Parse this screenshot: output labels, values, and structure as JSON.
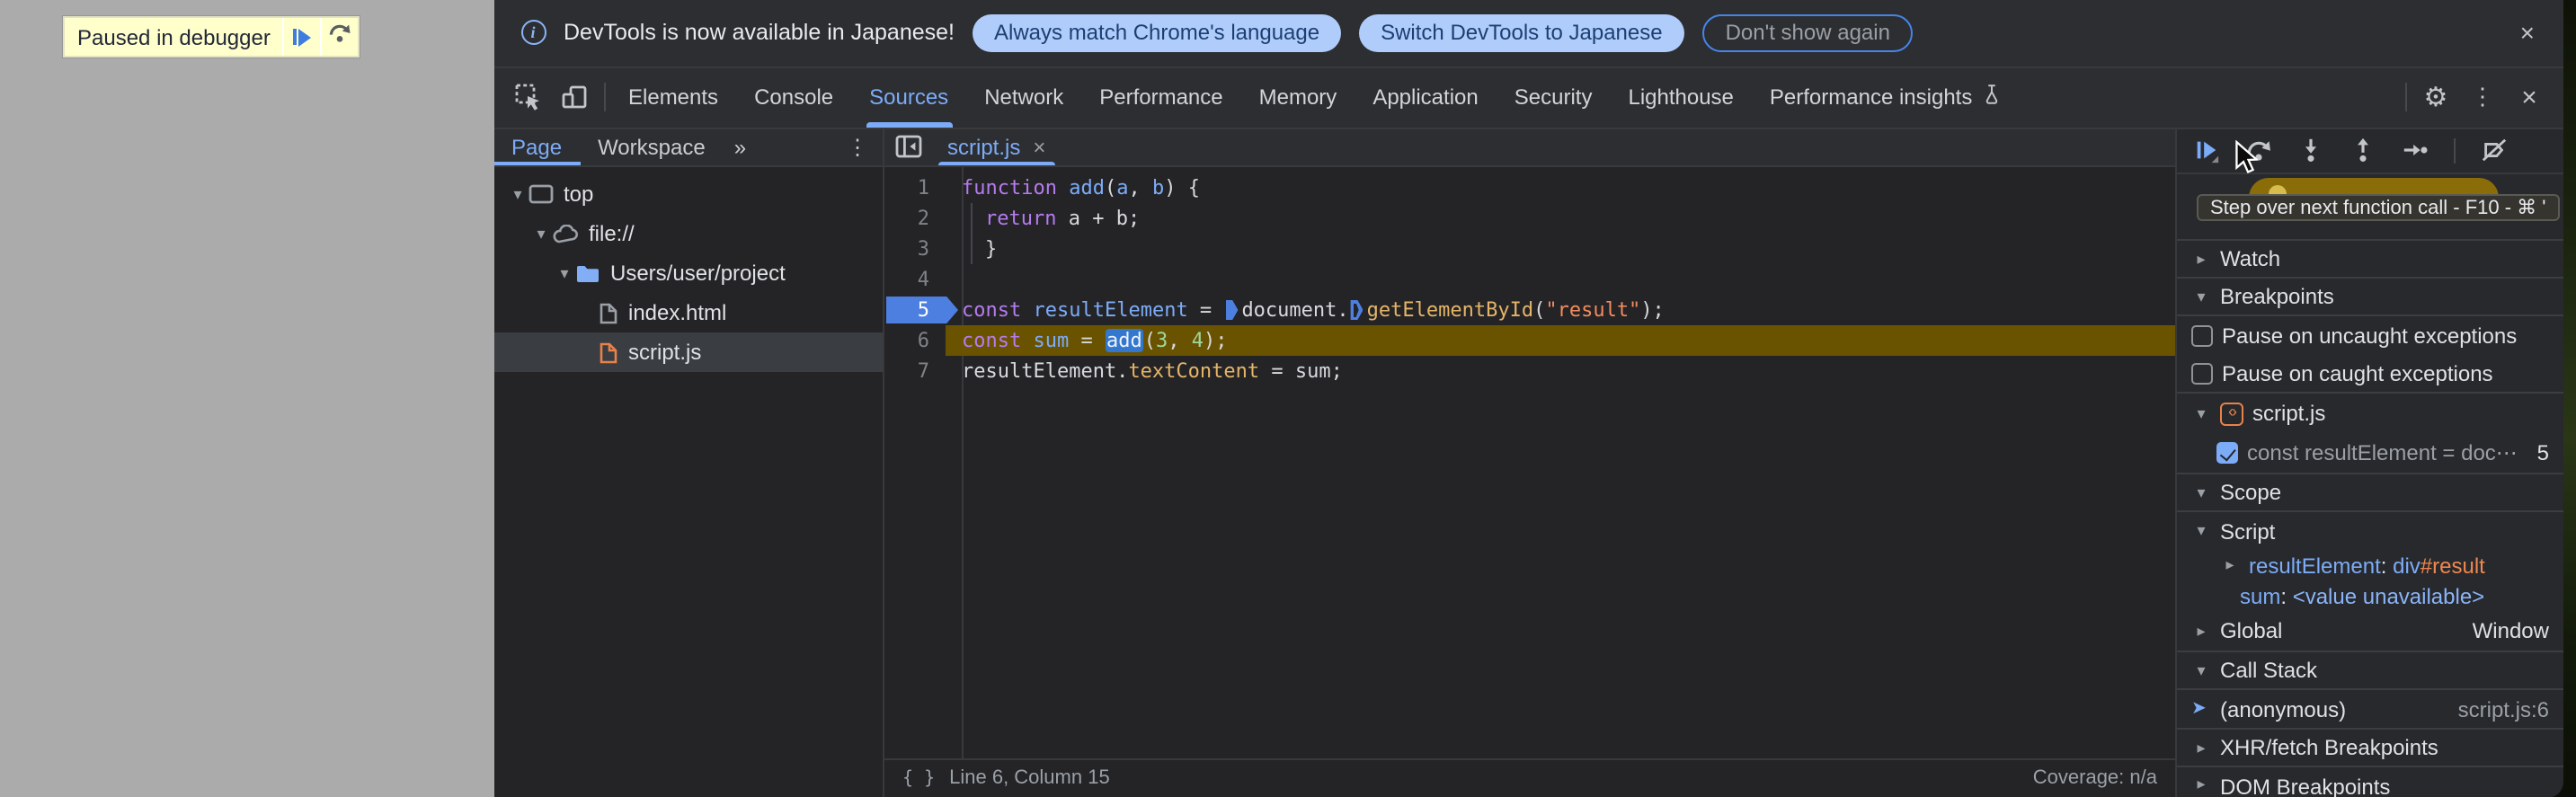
{
  "page_overlay": {
    "label": "Paused in debugger"
  },
  "banner": {
    "message": "DevTools is now available in Japanese!",
    "action_primary": "Always match Chrome's language",
    "action_secondary": "Switch DevTools to Japanese",
    "action_dismiss": "Don't show again"
  },
  "toolbar": {
    "tabs": [
      "Elements",
      "Console",
      "Sources",
      "Network",
      "Performance",
      "Memory",
      "Application",
      "Security",
      "Lighthouse",
      "Performance insights"
    ],
    "active_tab": "Sources"
  },
  "glyphs": {
    "kebab": "⋮",
    "close": "×",
    "gear": "⚙",
    "more": "»",
    "chevron_down": "▾",
    "chevron_right": "▸",
    "callstack_arrow": "➤",
    "code_icon": "‹›",
    "braces": "{ }",
    "info": "i"
  },
  "navigator": {
    "tab_page": "Page",
    "tab_workspace": "Workspace",
    "tree": [
      {
        "label": "top"
      },
      {
        "label": "file://"
      },
      {
        "label": "Users/user/project"
      },
      {
        "label": "index.html"
      },
      {
        "label": "script.js"
      }
    ]
  },
  "editor": {
    "open_tab": "script.js",
    "lines": [
      {
        "no": "1",
        "tokens": [
          {
            "t": "kw",
            "s": "function"
          },
          {
            "t": "p",
            "s": " "
          },
          {
            "t": "def",
            "s": "add"
          },
          {
            "t": "p",
            "s": "("
          },
          {
            "t": "def",
            "s": "a"
          },
          {
            "t": "p",
            "s": ", "
          },
          {
            "t": "def",
            "s": "b"
          },
          {
            "t": "p",
            "s": ") {"
          }
        ]
      },
      {
        "no": "2",
        "tokens": [
          {
            "t": "kw",
            "s": "return"
          },
          {
            "t": "p",
            "s": " a + b;"
          }
        ]
      },
      {
        "no": "3",
        "tokens": [
          {
            "t": "p",
            "s": "}"
          }
        ]
      },
      {
        "no": "4",
        "tokens": []
      },
      {
        "no": "5",
        "tokens": [
          {
            "t": "kw",
            "s": "const"
          },
          {
            "t": "p",
            "s": " "
          },
          {
            "t": "def",
            "s": "resultElement"
          },
          {
            "t": "p",
            "s": " = "
          },
          {
            "t": "mk"
          },
          {
            "t": "p",
            "s": "document."
          },
          {
            "t": "mko"
          },
          {
            "t": "call",
            "s": "getElementById"
          },
          {
            "t": "p",
            "s": "("
          },
          {
            "t": "str",
            "s": "\"result\""
          },
          {
            "t": "p",
            "s": ");"
          }
        ]
      },
      {
        "no": "6",
        "tokens": [
          {
            "t": "kw",
            "s": "const"
          },
          {
            "t": "p",
            "s": " "
          },
          {
            "t": "def",
            "s": "sum"
          },
          {
            "t": "p",
            "s": " = "
          },
          {
            "t": "sel",
            "s": "add"
          },
          {
            "t": "p",
            "s": "("
          },
          {
            "t": "num",
            "s": "3"
          },
          {
            "t": "p",
            "s": ", "
          },
          {
            "t": "num",
            "s": "4"
          },
          {
            "t": "p",
            "s": ");"
          }
        ]
      },
      {
        "no": "7",
        "tokens": [
          {
            "t": "p",
            "s": "resultElement."
          },
          {
            "t": "call",
            "s": "textContent"
          },
          {
            "t": "p",
            "s": " = sum;"
          }
        ]
      }
    ],
    "status": {
      "position": "Line 6, Column 15",
      "coverage": "Coverage: n/a"
    }
  },
  "debugger": {
    "tooltip": "Step over next function call - F10 - ⌘ '",
    "watch_label": "Watch",
    "breakpoints_label": "Breakpoints",
    "pause_uncaught": "Pause on uncaught exceptions",
    "pause_caught": "Pause on caught exceptions",
    "bp_file": "script.js",
    "bp_entry": {
      "code": "const resultElement = doc⋯",
      "line": "5"
    },
    "scope_label": "Scope",
    "scope_script_label": "Script",
    "var1": {
      "name": "resultElement",
      "sep": ": ",
      "value_tag": "div",
      "value_id": "#result"
    },
    "var2": {
      "name": "sum",
      "sep": ": ",
      "value": "<value unavailable>"
    },
    "global_label": "Global",
    "global_value": "Window",
    "callstack_label": "Call Stack",
    "frame": {
      "name": "(anonymous)",
      "location": "script.js:6"
    },
    "xhr_label": "XHR/fetch Breakpoints",
    "dom_label": "DOM Breakpoints"
  },
  "colors": {
    "accent_blue": "#7cacf8",
    "paused_overlay_bg": "#ffffcb",
    "execution_line_bg": "#6a5300",
    "breakpoint_blue": "#4d7fe0",
    "call_selection_bg": "#3377cf",
    "keyword": "#b57bee",
    "string": "#f28c5f",
    "number": "#9fd69f",
    "property": "#e5b567",
    "panel_bg": "#242427",
    "toolbar_bg": "#2d2e31"
  }
}
